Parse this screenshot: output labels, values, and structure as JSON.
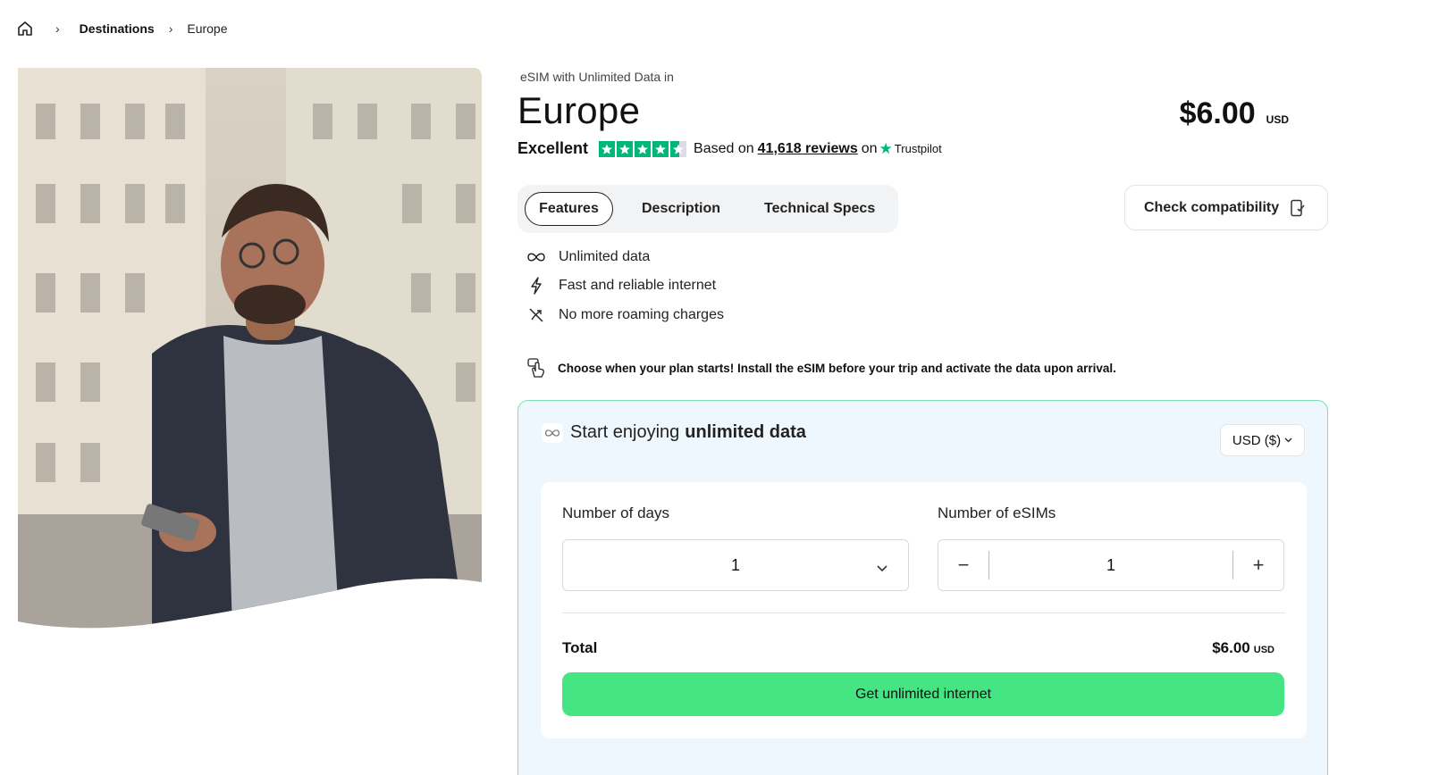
{
  "breadcrumb": {
    "home_icon": "home-icon",
    "items": [
      "Destinations",
      "Europe"
    ],
    "separator": "›"
  },
  "product": {
    "eyebrow": "eSIM with Unlimited Data in",
    "title": "Europe",
    "price": "$6.00",
    "price_currency": "USD"
  },
  "rating": {
    "label": "Excellent",
    "stars": 4.5,
    "based_on": "Based on",
    "reviews_link": "41,618 reviews",
    "on": "on",
    "provider": "Trustpilot",
    "star_color": "#00b67a"
  },
  "tabs": [
    {
      "label": "Features",
      "active": true
    },
    {
      "label": "Description",
      "active": false
    },
    {
      "label": "Technical Specs",
      "active": false
    }
  ],
  "compatibility": {
    "label": "Check compatibility",
    "icon": "phone-check-icon"
  },
  "features": [
    {
      "icon": "infinity-icon",
      "text": "Unlimited data"
    },
    {
      "icon": "lightning-icon",
      "text": "Fast and reliable internet"
    },
    {
      "icon": "no-roaming-icon",
      "text": "No more roaming charges"
    }
  ],
  "notice": {
    "icon": "tap-icon",
    "text": "Choose when your plan starts! Install the eSIM before your trip and activate the data upon arrival."
  },
  "purchase": {
    "heading_prefix": "Start enjoying",
    "heading_bold": "unlimited data",
    "currency_select": "USD ($)",
    "days_label": "Number of days",
    "days_value": "1",
    "esims_label": "Number of eSIMs",
    "esims_value": "1",
    "minus": "−",
    "plus": "+",
    "total_label": "Total",
    "total_value": "$6.00",
    "total_currency": "USD",
    "cta": "Get unlimited internet",
    "accent": "#46e583",
    "panel_bg": "#eef7fd",
    "panel_border": "#7fe0ad"
  }
}
